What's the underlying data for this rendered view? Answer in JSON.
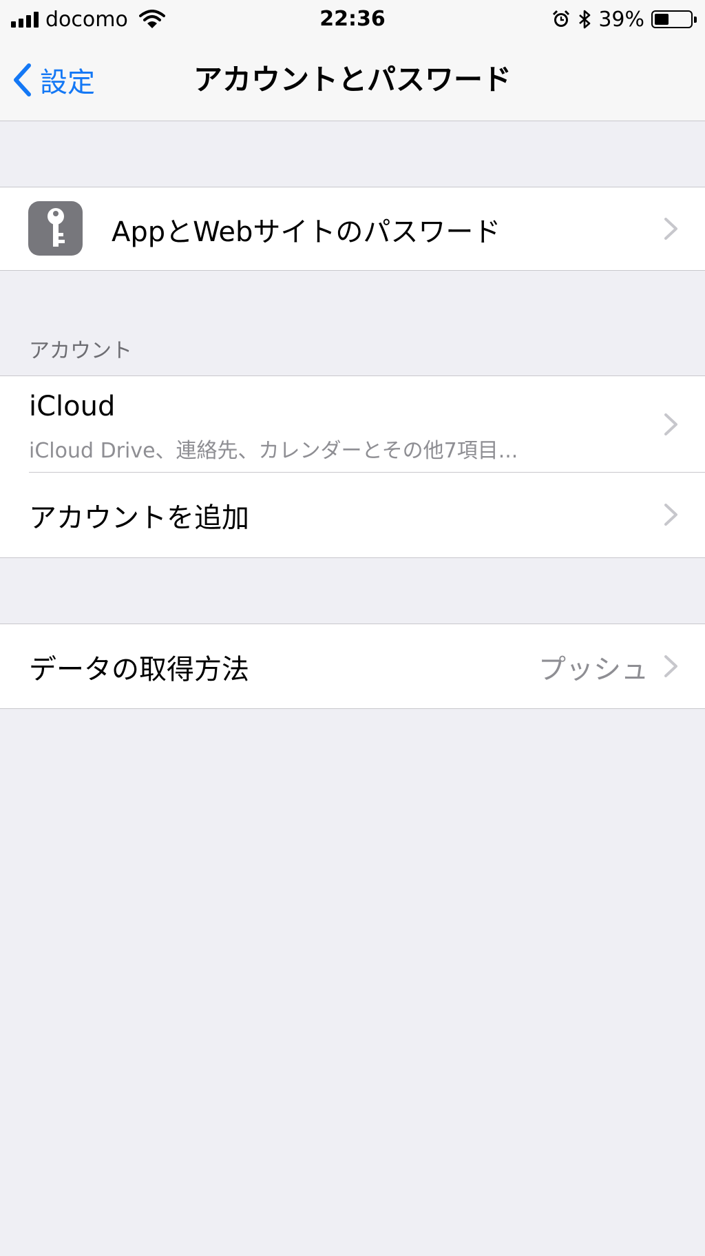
{
  "status_bar": {
    "carrier": "docomo",
    "time": "22:36",
    "battery_percent": "39%",
    "battery_level": 0.39,
    "icons": [
      "signal-icon",
      "wifi-icon",
      "alarm-icon",
      "bluetooth-icon",
      "battery-icon"
    ]
  },
  "nav": {
    "back_label": "設定",
    "title": "アカウントとパスワード"
  },
  "passwords_row": {
    "icon": "key-icon",
    "label": "AppとWebサイトのパスワード"
  },
  "accounts_section": {
    "header": "アカウント",
    "items": [
      {
        "title": "iCloud",
        "subtitle": "iCloud Drive、連絡先、カレンダーとその他7項目..."
      },
      {
        "title": "アカウントを追加"
      }
    ]
  },
  "fetch_row": {
    "label": "データの取得方法",
    "value": "プッシュ"
  },
  "colors": {
    "accent": "#1478f5",
    "background": "#efeff4",
    "icon_gray": "#77777c"
  }
}
